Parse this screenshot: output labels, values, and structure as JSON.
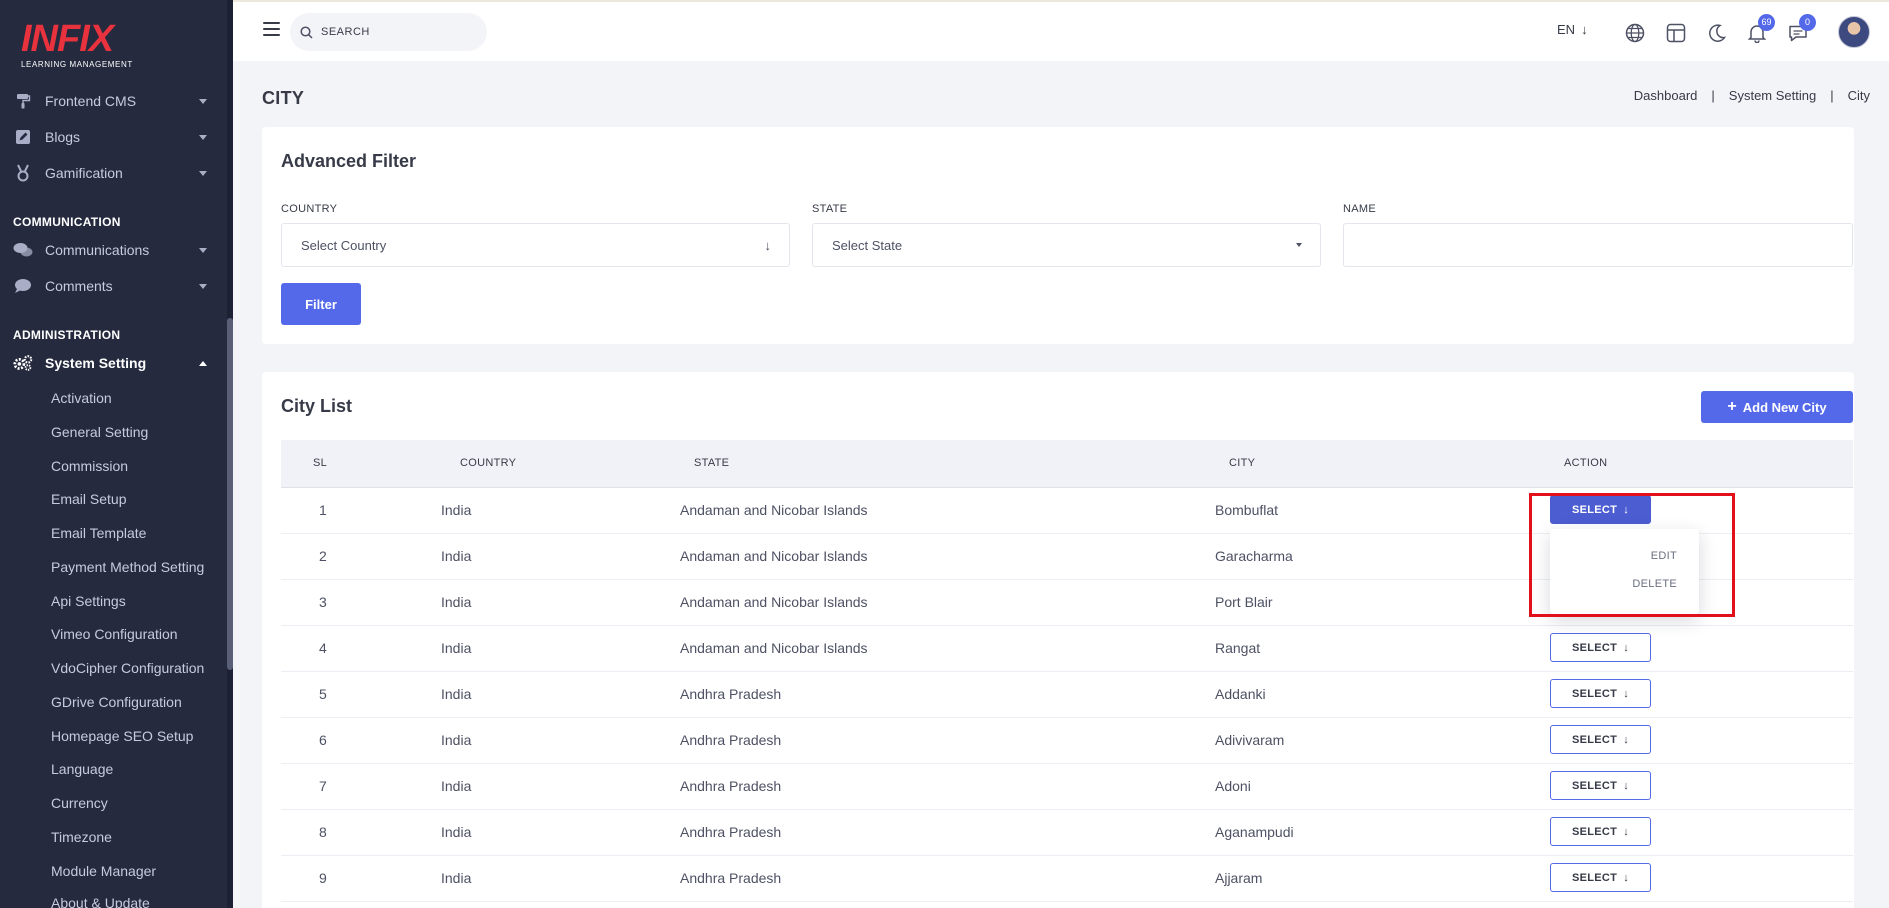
{
  "brand": {
    "logo_text": "INFIX",
    "logo_subtitle": "LEARNING MANAGEMENT",
    "logo_color": "#e8323d"
  },
  "sidebar": {
    "top_items": [
      {
        "label": "Frontend CMS",
        "icon": "paint-roller-icon"
      },
      {
        "label": "Blogs",
        "icon": "pencil-square-icon"
      },
      {
        "label": "Gamification",
        "icon": "medal-icon"
      }
    ],
    "sections": [
      {
        "title": "COMMUNICATION",
        "items": [
          {
            "label": "Communications",
            "icon": "chat-bubbles-icon"
          },
          {
            "label": "Comments",
            "icon": "comment-icon"
          }
        ]
      },
      {
        "title": "ADMINISTRATION",
        "items": [
          {
            "label": "System Setting",
            "icon": "gears-icon",
            "expanded": true
          }
        ]
      }
    ],
    "system_setting_children": [
      "Activation",
      "General Setting",
      "Commission",
      "Email Setup",
      "Email Template",
      "Payment Method Setting",
      "Api Settings",
      "Vimeo Configuration",
      "VdoCipher Configuration",
      "GDrive Configuration",
      "Homepage SEO Setup",
      "Language",
      "Currency",
      "Timezone",
      "Module Manager",
      "About & Update"
    ]
  },
  "topbar": {
    "search_placeholder": "SEARCH",
    "language": "EN",
    "notifications_count": "69",
    "messages_count": "0",
    "accent_color": "#5469e9"
  },
  "page": {
    "title": "CITY",
    "breadcrumb": [
      "Dashboard",
      "System Setting",
      "City"
    ],
    "breadcrumb_separator": "|"
  },
  "filter": {
    "title": "Advanced Filter",
    "country_label": "COUNTRY",
    "country_placeholder": "Select Country",
    "state_label": "STATE",
    "state_placeholder": "Select State",
    "name_label": "NAME",
    "name_value": "",
    "button_label": "Filter"
  },
  "city_list": {
    "title": "City List",
    "add_button_label": "Add New City",
    "columns": [
      "SL",
      "COUNTRY",
      "STATE",
      "CITY",
      "ACTION"
    ],
    "rows": [
      {
        "sl": "1",
        "country": "India",
        "state": "Andaman and Nicobar Islands",
        "city": "Bombuflat"
      },
      {
        "sl": "2",
        "country": "India",
        "state": "Andaman and Nicobar Islands",
        "city": "Garacharma"
      },
      {
        "sl": "3",
        "country": "India",
        "state": "Andaman and Nicobar Islands",
        "city": "Port Blair"
      },
      {
        "sl": "4",
        "country": "India",
        "state": "Andaman and Nicobar Islands",
        "city": "Rangat"
      },
      {
        "sl": "5",
        "country": "India",
        "state": "Andhra Pradesh",
        "city": "Addanki"
      },
      {
        "sl": "6",
        "country": "India",
        "state": "Andhra Pradesh",
        "city": "Adivivaram"
      },
      {
        "sl": "7",
        "country": "India",
        "state": "Andhra Pradesh",
        "city": "Adoni"
      },
      {
        "sl": "8",
        "country": "India",
        "state": "Andhra Pradesh",
        "city": "Aganampudi"
      },
      {
        "sl": "9",
        "country": "India",
        "state": "Andhra Pradesh",
        "city": "Ajjaram"
      }
    ],
    "action_label": "SELECT",
    "action_menu": [
      "EDIT",
      "DELETE"
    ],
    "highlight_color": "#e2101a"
  }
}
